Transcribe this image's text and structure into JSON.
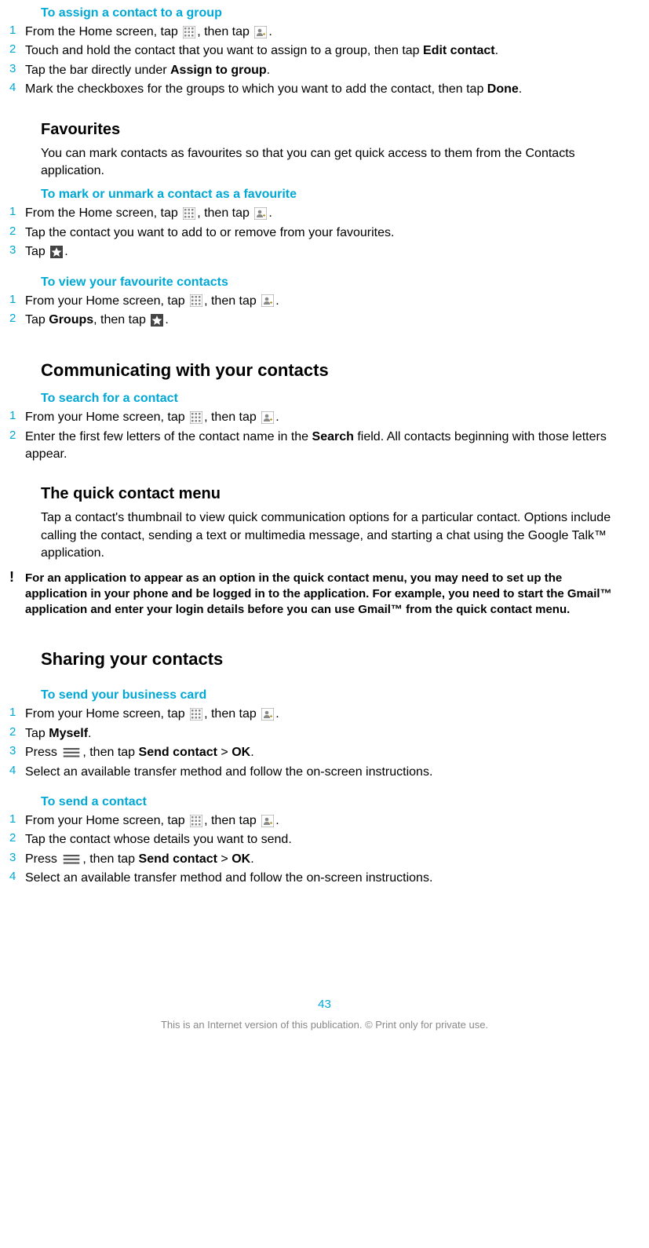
{
  "s1": {
    "title": "To assign a contact to a group",
    "steps": [
      {
        "n": "1",
        "pre": "From the Home screen, tap ",
        "mid": ", then tap ",
        "post": "."
      },
      {
        "n": "2",
        "a": "Touch and hold the contact that you want to assign to a group, then tap ",
        "b": "Edit contact",
        "c": "."
      },
      {
        "n": "3",
        "a": "Tap the bar directly under ",
        "b": "Assign to group",
        "c": "."
      },
      {
        "n": "4",
        "a": "Mark the checkboxes for the groups to which you want to add the contact, then tap ",
        "b": "Done",
        "c": "."
      }
    ]
  },
  "favourites": {
    "heading": "Favourites",
    "body": "You can mark contacts as favourites so that you can get quick access to them from the Contacts application."
  },
  "s2": {
    "title": "To mark or unmark a contact as a favourite",
    "steps": [
      {
        "n": "1",
        "pre": "From the Home screen, tap ",
        "mid": ", then tap ",
        "post": "."
      },
      {
        "n": "2",
        "text": "Tap the contact you want to add to or remove from your favourites."
      },
      {
        "n": "3",
        "pre": "Tap ",
        "post": "."
      }
    ]
  },
  "s3": {
    "title": "To view your favourite contacts",
    "steps": [
      {
        "n": "1",
        "pre": "From your Home screen, tap ",
        "mid": ", then tap ",
        "post": "."
      },
      {
        "n": "2",
        "a": "Tap ",
        "b": "Groups",
        "c": ", then tap ",
        "post": "."
      }
    ]
  },
  "comm": {
    "heading": "Communicating with your contacts"
  },
  "s4": {
    "title": "To search for a contact",
    "steps": [
      {
        "n": "1",
        "pre": "From your Home screen, tap ",
        "mid": ", then tap ",
        "post": "."
      },
      {
        "n": "2",
        "a": "Enter the first few letters of the contact name in the ",
        "b": "Search",
        "c": " field. All contacts beginning with those letters appear."
      }
    ]
  },
  "quick": {
    "heading": "The quick contact menu",
    "body": "Tap a contact's thumbnail to view quick communication options for a particular contact. Options include calling the contact, sending a text or multimedia message, and starting a chat using the Google Talk™ application.",
    "note": "For an application to appear as an option in the quick contact menu, you may need to set up the application in your phone and be logged in to the application. For example, you need to start the Gmail™ application and enter your login details before you can use Gmail™ from the quick contact menu."
  },
  "sharing": {
    "heading": "Sharing your contacts"
  },
  "s5": {
    "title": "To send your business card",
    "steps": [
      {
        "n": "1",
        "pre": "From your Home screen, tap ",
        "mid": ", then tap ",
        "post": "."
      },
      {
        "n": "2",
        "a": "Tap ",
        "b": "Myself",
        "c": "."
      },
      {
        "n": "3",
        "a": "Press ",
        "b": ", then tap ",
        "c": "Send contact",
        "d": " > ",
        "e": "OK",
        "f": "."
      },
      {
        "n": "4",
        "text": "Select an available transfer method and follow the on-screen instructions."
      }
    ]
  },
  "s6": {
    "title": "To send a contact",
    "steps": [
      {
        "n": "1",
        "pre": "From your Home screen, tap ",
        "mid": ", then tap ",
        "post": "."
      },
      {
        "n": "2",
        "text": "Tap the contact whose details you want to send."
      },
      {
        "n": "3",
        "a": "Press ",
        "b": ", then tap ",
        "c": "Send contact",
        "d": " > ",
        "e": "OK",
        "f": "."
      },
      {
        "n": "4",
        "text": "Select an available transfer method and follow the on-screen instructions."
      }
    ]
  },
  "page_number": "43",
  "footer": "This is an Internet version of this publication. © Print only for private use."
}
